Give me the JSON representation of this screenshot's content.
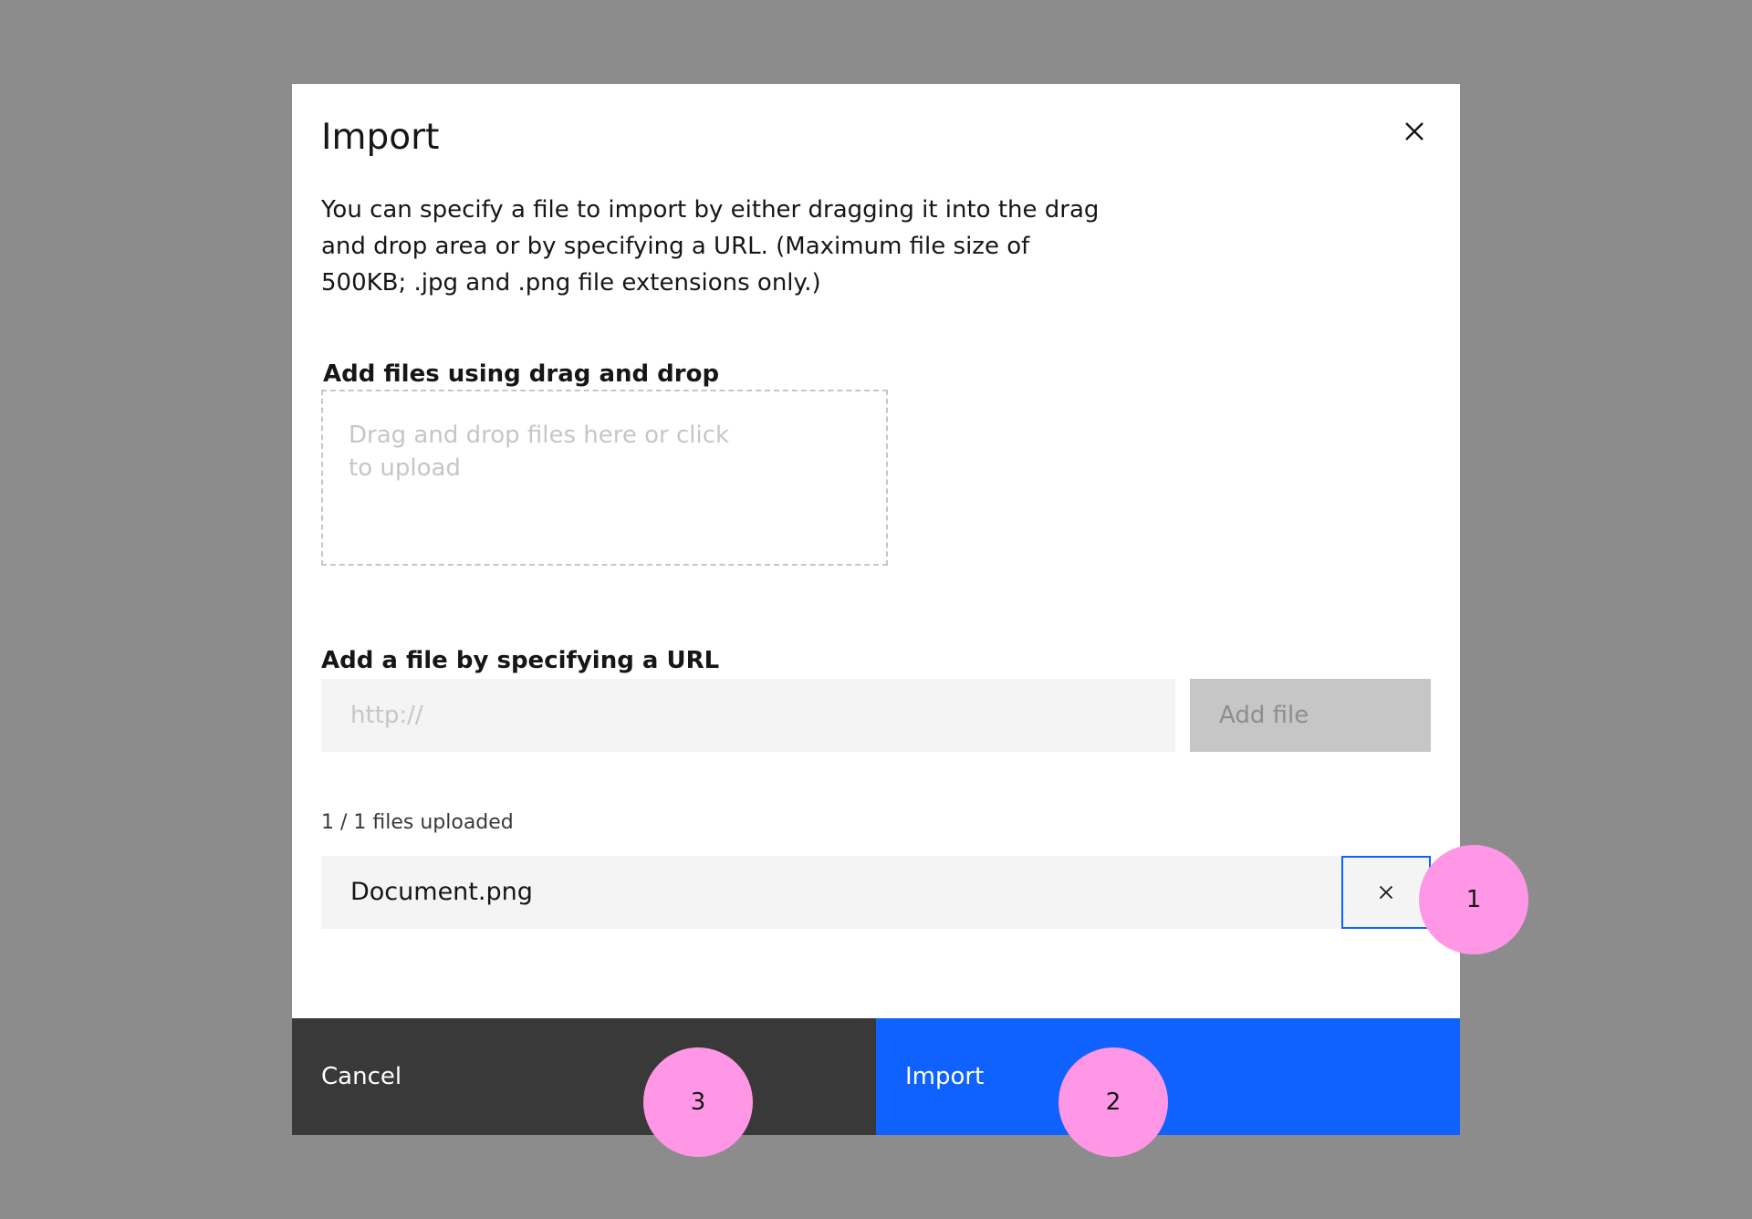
{
  "modal": {
    "title": "Import",
    "description": "You can specify a file to import by either dragging it into the drag and drop area or by specifying a URL. (Maximum file size of 500KB; .jpg and .png file extensions only.)"
  },
  "drag_drop": {
    "label": "Add files using drag and drop",
    "placeholder": "Drag and drop files here or click to upload"
  },
  "url_section": {
    "label": "Add a file by specifying a URL",
    "input_value": "",
    "input_placeholder": "http://",
    "add_button_label": "Add file"
  },
  "uploads": {
    "status": "1 / 1 files uploaded",
    "files": [
      {
        "name": "Document.png"
      }
    ]
  },
  "footer": {
    "cancel_label": "Cancel",
    "import_label": "Import"
  },
  "annotations": [
    "1",
    "2",
    "3"
  ],
  "colors": {
    "overlay": "#8c8c8c",
    "primary": "#0f62fe",
    "secondary": "#393939",
    "field_background": "#f4f4f4",
    "disabled": "#c6c6c6",
    "annotation_marker": "#ff96e6"
  },
  "icons": {
    "modal_close": "close-icon",
    "file_remove": "close-icon"
  }
}
